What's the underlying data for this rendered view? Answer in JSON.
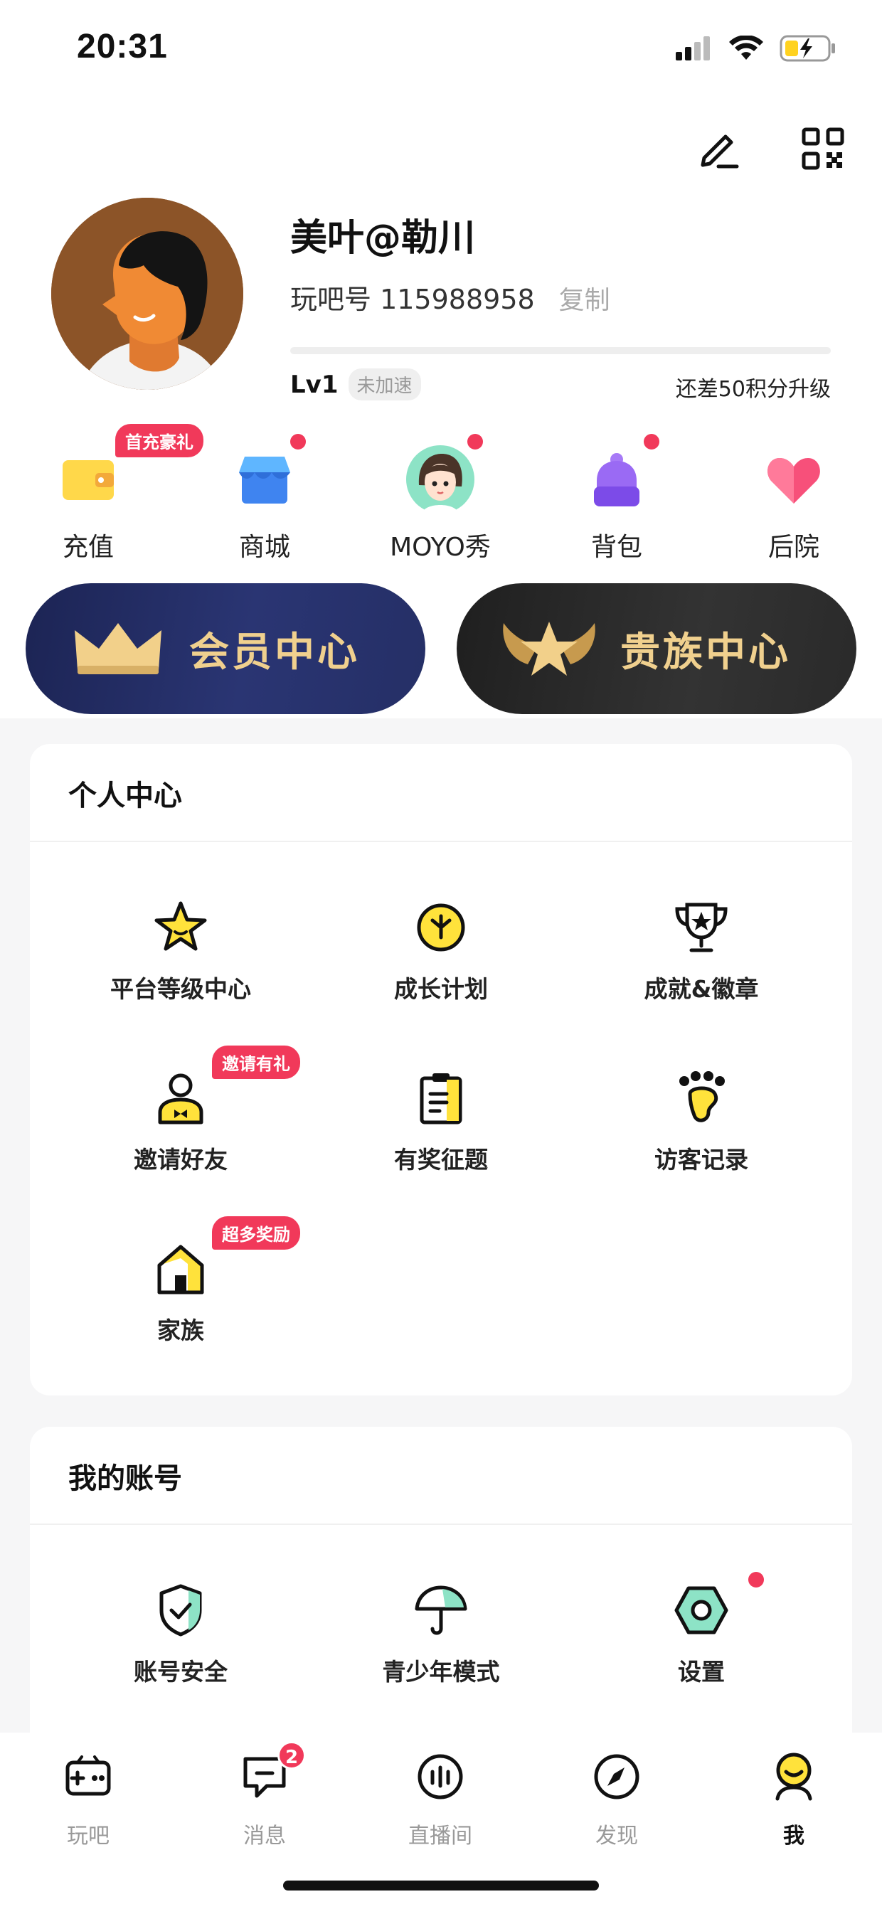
{
  "status_bar": {
    "time": "20:31"
  },
  "profile": {
    "nickname": "美叶@勒川",
    "uid_label": "玩吧号 115988958",
    "copy_label": "复制",
    "level": "Lv1",
    "speed_badge": "未加速",
    "level_hint": "还差50积分升级",
    "level_progress": 0
  },
  "quick_actions": [
    {
      "label": "充值",
      "icon": "wallet-icon",
      "tag": "首充豪礼"
    },
    {
      "label": "商城",
      "icon": "store-icon"
    },
    {
      "label": "MOYO秀",
      "icon": "moyo-avatar-icon"
    },
    {
      "label": "背包",
      "icon": "backpack-icon"
    },
    {
      "label": "后院",
      "icon": "heart-icon"
    }
  ],
  "vip": {
    "member_label": "会员中心",
    "noble_label": "贵族中心"
  },
  "personal_center": {
    "title": "个人中心",
    "items": [
      {
        "label": "平台等级中心",
        "icon": "star-icon"
      },
      {
        "label": "成长计划",
        "icon": "sprout-clock-icon"
      },
      {
        "label": "成就&徽章",
        "icon": "trophy-icon"
      },
      {
        "label": "邀请好友",
        "icon": "invite-user-icon",
        "tag": "邀请有礼"
      },
      {
        "label": "有奖征题",
        "icon": "clipboard-icon"
      },
      {
        "label": "访客记录",
        "icon": "footprint-icon"
      },
      {
        "label": "家族",
        "icon": "house-icon",
        "tag": "超多奖励"
      }
    ]
  },
  "my_account": {
    "title": "我的账号",
    "items": [
      {
        "label": "账号安全",
        "icon": "shield-check-icon"
      },
      {
        "label": "青少年模式",
        "icon": "umbrella-icon"
      },
      {
        "label": "设置",
        "icon": "hex-nut-settings-icon"
      }
    ]
  },
  "tabbar": [
    {
      "label": "玩吧",
      "icon": "gamepad-icon"
    },
    {
      "label": "消息",
      "icon": "message-icon",
      "badge": "2"
    },
    {
      "label": "直播间",
      "icon": "live-icon"
    },
    {
      "label": "发现",
      "icon": "compass-icon"
    },
    {
      "label": "我",
      "icon": "me-icon",
      "active": true
    }
  ],
  "colors": {
    "accent_yellow": "#ffe23b",
    "badge_red": "#f1395a",
    "member_bg": "#222c66",
    "noble_bg": "#2b2b2b",
    "vip_gold": "#f0d08e"
  }
}
